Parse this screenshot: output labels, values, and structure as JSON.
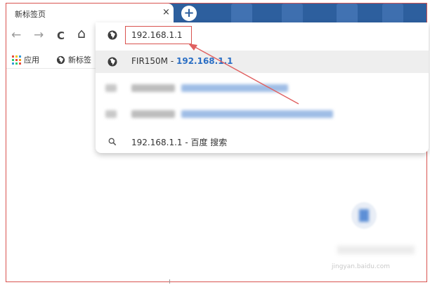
{
  "tab": {
    "title": "新标签页",
    "close": "×"
  },
  "new_tab_label": "+",
  "nav": {
    "back": "←",
    "forward": "→",
    "reload": "C",
    "home": "⌂"
  },
  "bookmarks": [
    {
      "label": "应用",
      "icon": "apps-icon"
    },
    {
      "label": "新标签",
      "icon": "globe-icon"
    }
  ],
  "omnibox": {
    "value": "192.168.1.1"
  },
  "suggestions": [
    {
      "prefix": "FIR150M - ",
      "highlight": "192.168.1.1",
      "icon": "globe-icon"
    },
    {
      "text": "192.168.1.1 - 百度 搜索",
      "icon": "search-icon"
    }
  ],
  "watermark": "jingyan.baidu.com",
  "colors": {
    "tabstrip": "#2d5f9e",
    "highlight": "#2a6ec4",
    "annotation": "#d9534f",
    "selected_row": "#eeeeee"
  }
}
